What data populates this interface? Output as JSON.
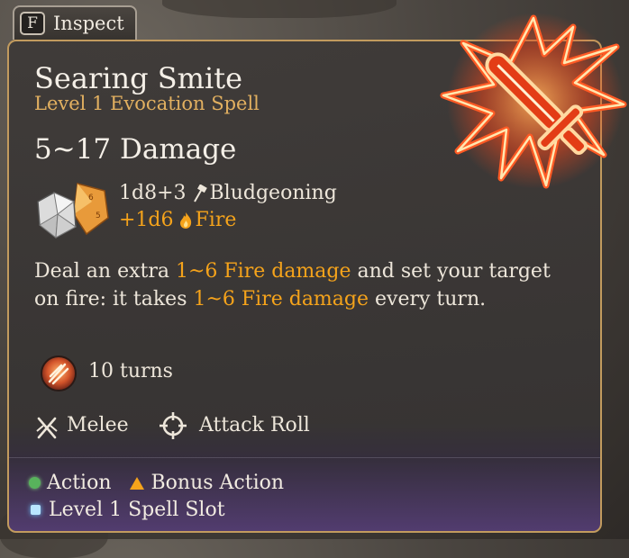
{
  "inspect_tab": {
    "key": "F",
    "label": "Inspect"
  },
  "spell": {
    "name": "Searing Smite",
    "subtitle": "Level 1 Evocation Spell",
    "damage_total": "5~17 Damage",
    "damage_lines": [
      {
        "dice": "1d8+3",
        "type": "Bludgeoning",
        "icon": "hammer-icon"
      },
      {
        "dice": "+1d6",
        "type": "Fire",
        "icon": "flame-icon"
      }
    ],
    "description": {
      "p1": "Deal an extra ",
      "h1": "1~6 Fire damage",
      "p2": " and set your target on fire: it takes ",
      "h2": "1~6 Fire damage",
      "p3": " every turn."
    },
    "duration": "10 turns",
    "range": "Melee",
    "roll": "Attack Roll"
  },
  "costs": {
    "action": "Action",
    "bonus_action": "Bonus Action",
    "spell_slot": "Level 1 Spell Slot"
  },
  "colors": {
    "highlight": "#f5a31b",
    "subtitle": "#e2b060",
    "text": "#ede6da",
    "border": "#c29b5e",
    "action": "#58b35c",
    "spell_slot": "#b9e6ff"
  }
}
